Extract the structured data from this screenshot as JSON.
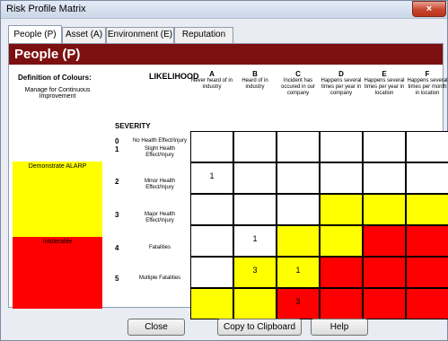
{
  "window": {
    "title": "Risk Profile Matrix",
    "close_glyph": "×"
  },
  "tabs": [
    {
      "label": "People (P)",
      "active": true
    },
    {
      "label": "Asset (A)",
      "active": false
    },
    {
      "label": "Environment (E)",
      "active": false
    },
    {
      "label": "Reputation (R)",
      "active": false
    }
  ],
  "panel": {
    "heading": "People (P)",
    "heading_color": "#7c1010",
    "definition_title": "Definition of Colours:",
    "legend": [
      {
        "label": "Manage for Continuous Improvement",
        "color": "#ffffff"
      },
      {
        "label": "Demonstrate ALARP",
        "color": "#ffff00"
      },
      {
        "label": "Intolerable",
        "color": "#ff0000"
      }
    ],
    "likelihood_label": "LIKELIHOOD",
    "severity_label": "SEVERITY",
    "columns": [
      {
        "letter": "A",
        "desc": "Never heard of in industry"
      },
      {
        "letter": "B",
        "desc": "Heard of in industry"
      },
      {
        "letter": "C",
        "desc": "Incident has occured in our company"
      },
      {
        "letter": "D",
        "desc": "Happens several times per year in company"
      },
      {
        "letter": "E",
        "desc": "Happens several times per year in location"
      },
      {
        "letter": "F",
        "desc": "Happens several times per month in location"
      }
    ],
    "rows": [
      {
        "num": "0",
        "desc": "No Health Effect/Injury"
      },
      {
        "num": "1",
        "desc": "Slight Health Effect/Injury"
      },
      {
        "num": "2",
        "desc": "Minor Health Effect/Injury"
      },
      {
        "num": "3",
        "desc": "Major Health Effect/Injury"
      },
      {
        "num": "4",
        "desc": "Fatalities"
      },
      {
        "num": "5",
        "desc": "Multiple Fatalities"
      }
    ],
    "matrix_colors": [
      [
        "w",
        "w",
        "w",
        "w",
        "w",
        "w"
      ],
      [
        "w",
        "w",
        "w",
        "w",
        "w",
        "w"
      ],
      [
        "w",
        "w",
        "w",
        "y",
        "y",
        "y"
      ],
      [
        "w",
        "w",
        "y",
        "y",
        "r",
        "r"
      ],
      [
        "w",
        "y",
        "y",
        "r",
        "r",
        "r"
      ],
      [
        "y",
        "y",
        "r",
        "r",
        "r",
        "r"
      ]
    ],
    "matrix_values": [
      [
        "",
        "",
        "",
        "",
        "",
        ""
      ],
      [
        "1",
        "",
        "",
        "",
        "",
        ""
      ],
      [
        "",
        "",
        "",
        "",
        "",
        ""
      ],
      [
        "",
        "1",
        "",
        "",
        "",
        ""
      ],
      [
        "",
        "3",
        "1",
        "",
        "",
        ""
      ],
      [
        "",
        "",
        "3",
        "",
        "",
        ""
      ]
    ],
    "colors": {
      "w": "#ffffff",
      "y": "#ffff00",
      "r": "#ff0000"
    }
  },
  "buttons": {
    "close": "Close",
    "copy": "Copy to Clipboard",
    "help": "Help"
  }
}
